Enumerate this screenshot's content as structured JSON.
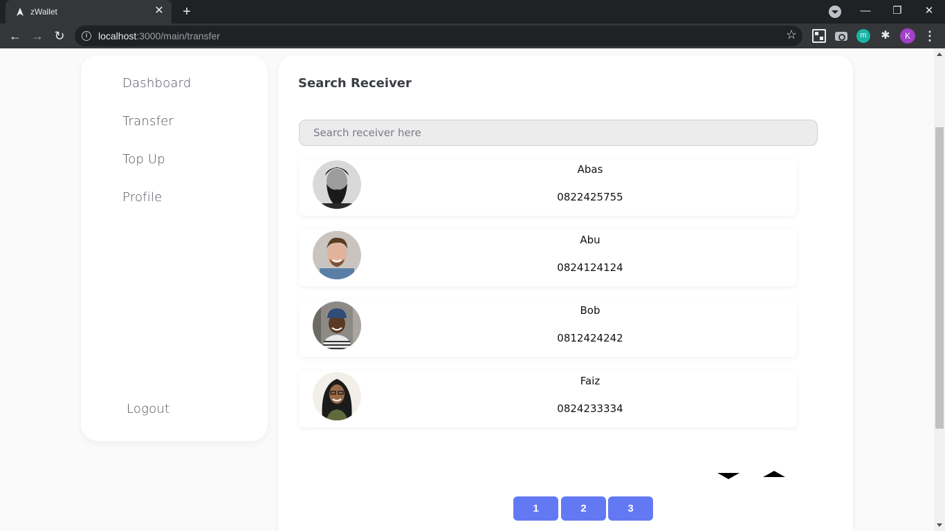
{
  "browser": {
    "tab_title": "zWallet",
    "tab_close": "✕",
    "new_tab": "+",
    "url_host": "localhost",
    "url_rest": ":3000/main/transfer",
    "profile_initial": "K",
    "ext_m_label": "m",
    "window_controls": {
      "minimize": "—",
      "restore": "❐",
      "close": "✕"
    }
  },
  "sidebar": {
    "items": [
      {
        "label": "Dashboard"
      },
      {
        "label": "Transfer"
      },
      {
        "label": "Top Up"
      },
      {
        "label": "Profile"
      }
    ],
    "logout": "Logout"
  },
  "main": {
    "title": "Search Receiver",
    "search_placeholder": "Search receiver here",
    "receivers": [
      {
        "name": "Abas",
        "phone": "0822425755"
      },
      {
        "name": "Abu",
        "phone": "0824124124"
      },
      {
        "name": "Bob",
        "phone": "0812424242"
      },
      {
        "name": "Faiz",
        "phone": "0824233334"
      }
    ],
    "pages": [
      "1",
      "2",
      "3"
    ]
  },
  "colors": {
    "accent": "#6379f4",
    "nav_text": "#4d4b57",
    "page_bg": "#fafafa"
  }
}
